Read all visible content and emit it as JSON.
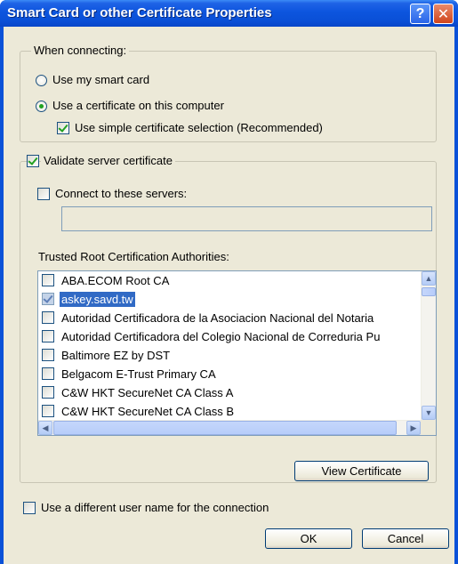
{
  "window": {
    "title": "Smart Card or other Certificate Properties",
    "help_glyph": "?",
    "close_glyph": "✕"
  },
  "connecting": {
    "legend": "When connecting:",
    "use_smart_card": {
      "label": "Use my smart card",
      "selected": false
    },
    "use_certificate": {
      "label": "Use a certificate on this computer",
      "selected": true
    },
    "simple_selection": {
      "label": "Use simple certificate selection (Recommended)",
      "checked": true
    }
  },
  "validate": {
    "label": "Validate server certificate",
    "checked": true,
    "connect_servers": {
      "label": "Connect to these servers:",
      "checked": false,
      "value": ""
    },
    "trusted_label": "Trusted Root Certification Authorities:",
    "authorities": [
      {
        "name": "ABA.ECOM Root CA",
        "checked": false,
        "selected": false
      },
      {
        "name": "askey.savd.tw",
        "checked": true,
        "selected": true
      },
      {
        "name": "Autoridad Certificadora de la Asociacion Nacional del Notaria",
        "checked": false,
        "selected": false
      },
      {
        "name": "Autoridad Certificadora del Colegio Nacional de Correduria Pu",
        "checked": false,
        "selected": false
      },
      {
        "name": "Baltimore EZ by DST",
        "checked": false,
        "selected": false
      },
      {
        "name": "Belgacom E-Trust Primary CA",
        "checked": false,
        "selected": false
      },
      {
        "name": "C&W HKT SecureNet CA Class A",
        "checked": false,
        "selected": false
      },
      {
        "name": "C&W HKT SecureNet CA Class B",
        "checked": false,
        "selected": false
      }
    ],
    "view_certificate": "View Certificate"
  },
  "different_user": {
    "label": "Use a different user name for the connection",
    "checked": false
  },
  "buttons": {
    "ok": "OK",
    "cancel": "Cancel"
  }
}
